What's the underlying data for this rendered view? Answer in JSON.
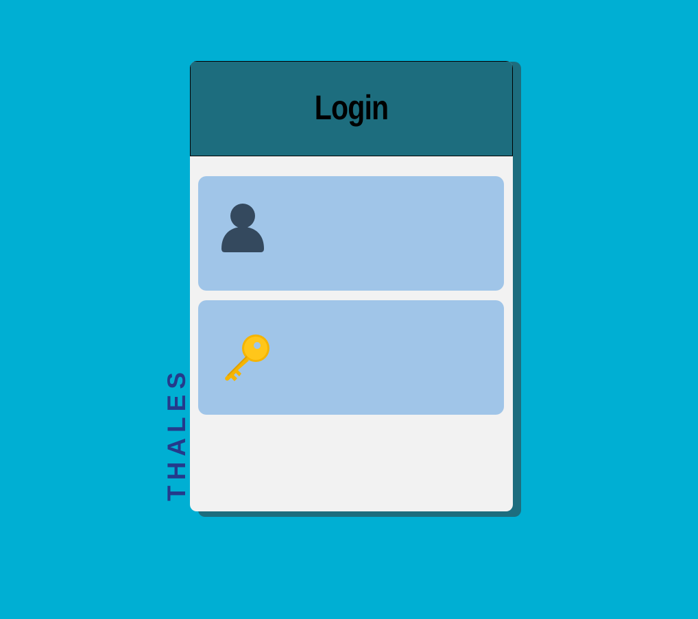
{
  "login": {
    "title": "Login",
    "username": {
      "icon": "user-icon",
      "value": "",
      "placeholder": ""
    },
    "password": {
      "icon": "key-icon",
      "value": "",
      "placeholder": ""
    }
  },
  "brand": {
    "logo_text": "THALES"
  },
  "colors": {
    "background": "#00AFD3",
    "header": "#1D6D7E",
    "card": "#F2F2F2",
    "field": "#A0C5E8",
    "user_icon": "#34495E",
    "key_icon": "#F5B400",
    "logo": "#243A8B"
  }
}
